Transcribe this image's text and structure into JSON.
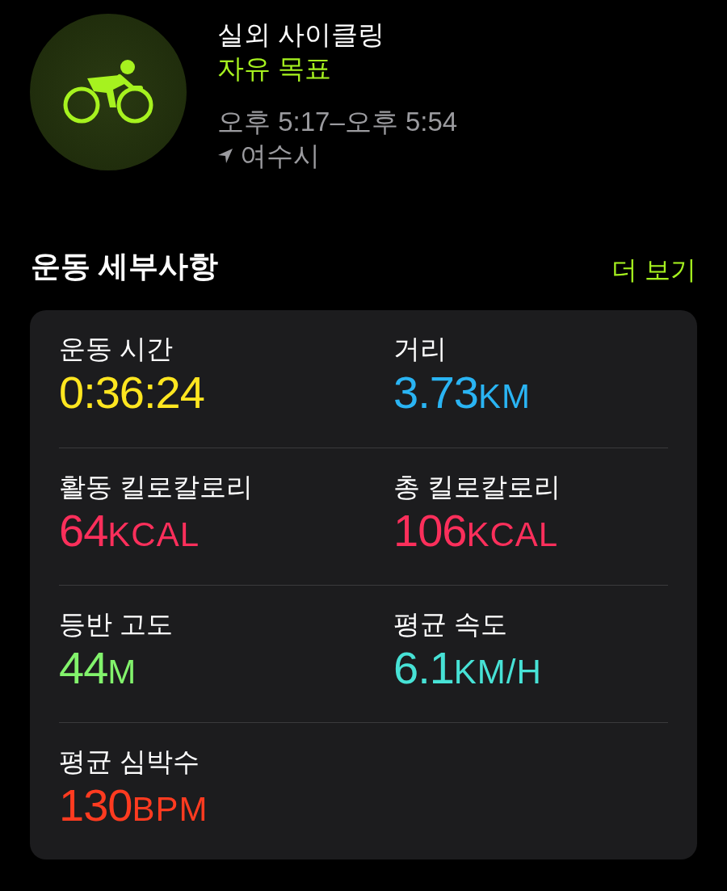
{
  "workout": {
    "title": "실외 사이클링",
    "goal": "자유 목표",
    "time_range": "오후 5:17–오후 5:54",
    "location": "여수시"
  },
  "details": {
    "heading": "운동 세부사항",
    "more_link": "더 보기",
    "metrics": [
      {
        "label": "운동 시간",
        "value": "0:36:24",
        "color": "#ffe620"
      },
      {
        "label": "거리",
        "value": "3.73",
        "unit": "KM",
        "color": "#2ab4f3"
      },
      {
        "label": "활동 킬로칼로리",
        "value": "64",
        "unit": "KCAL",
        "color": "#fb2f5b"
      },
      {
        "label": "총 킬로칼로리",
        "value": "106",
        "unit": "KCAL",
        "color": "#fb2f5b"
      },
      {
        "label": "등반 고도",
        "value": "44",
        "unit": "M",
        "color": "#82f36c"
      },
      {
        "label": "평균 속도",
        "value": "6.1",
        "unit": "KM/H",
        "color": "#47e2d6"
      },
      {
        "label": "평균 심박수",
        "value": "130",
        "unit": "BPM",
        "color": "#ff3b20"
      }
    ]
  }
}
